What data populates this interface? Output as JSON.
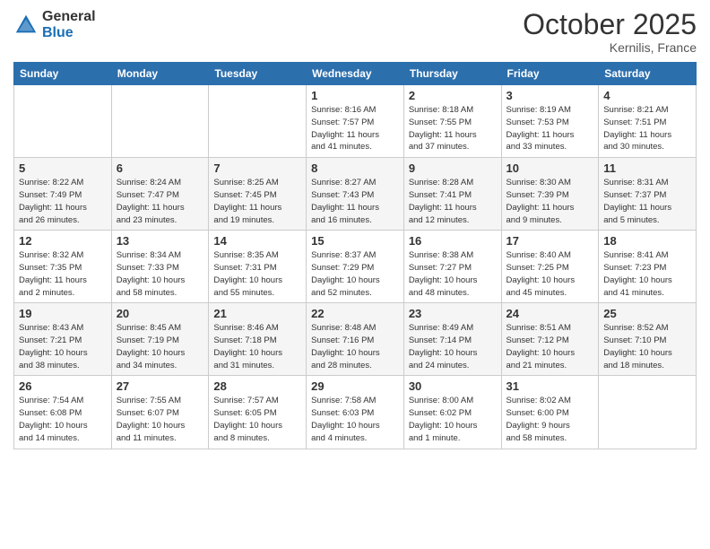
{
  "logo": {
    "general": "General",
    "blue": "Blue"
  },
  "header": {
    "month": "October 2025",
    "location": "Kernilis, France"
  },
  "weekdays": [
    "Sunday",
    "Monday",
    "Tuesday",
    "Wednesday",
    "Thursday",
    "Friday",
    "Saturday"
  ],
  "weeks": [
    [
      {
        "day": "",
        "info": ""
      },
      {
        "day": "",
        "info": ""
      },
      {
        "day": "",
        "info": ""
      },
      {
        "day": "1",
        "info": "Sunrise: 8:16 AM\nSunset: 7:57 PM\nDaylight: 11 hours\nand 41 minutes."
      },
      {
        "day": "2",
        "info": "Sunrise: 8:18 AM\nSunset: 7:55 PM\nDaylight: 11 hours\nand 37 minutes."
      },
      {
        "day": "3",
        "info": "Sunrise: 8:19 AM\nSunset: 7:53 PM\nDaylight: 11 hours\nand 33 minutes."
      },
      {
        "day": "4",
        "info": "Sunrise: 8:21 AM\nSunset: 7:51 PM\nDaylight: 11 hours\nand 30 minutes."
      }
    ],
    [
      {
        "day": "5",
        "info": "Sunrise: 8:22 AM\nSunset: 7:49 PM\nDaylight: 11 hours\nand 26 minutes."
      },
      {
        "day": "6",
        "info": "Sunrise: 8:24 AM\nSunset: 7:47 PM\nDaylight: 11 hours\nand 23 minutes."
      },
      {
        "day": "7",
        "info": "Sunrise: 8:25 AM\nSunset: 7:45 PM\nDaylight: 11 hours\nand 19 minutes."
      },
      {
        "day": "8",
        "info": "Sunrise: 8:27 AM\nSunset: 7:43 PM\nDaylight: 11 hours\nand 16 minutes."
      },
      {
        "day": "9",
        "info": "Sunrise: 8:28 AM\nSunset: 7:41 PM\nDaylight: 11 hours\nand 12 minutes."
      },
      {
        "day": "10",
        "info": "Sunrise: 8:30 AM\nSunset: 7:39 PM\nDaylight: 11 hours\nand 9 minutes."
      },
      {
        "day": "11",
        "info": "Sunrise: 8:31 AM\nSunset: 7:37 PM\nDaylight: 11 hours\nand 5 minutes."
      }
    ],
    [
      {
        "day": "12",
        "info": "Sunrise: 8:32 AM\nSunset: 7:35 PM\nDaylight: 11 hours\nand 2 minutes."
      },
      {
        "day": "13",
        "info": "Sunrise: 8:34 AM\nSunset: 7:33 PM\nDaylight: 10 hours\nand 58 minutes."
      },
      {
        "day": "14",
        "info": "Sunrise: 8:35 AM\nSunset: 7:31 PM\nDaylight: 10 hours\nand 55 minutes."
      },
      {
        "day": "15",
        "info": "Sunrise: 8:37 AM\nSunset: 7:29 PM\nDaylight: 10 hours\nand 52 minutes."
      },
      {
        "day": "16",
        "info": "Sunrise: 8:38 AM\nSunset: 7:27 PM\nDaylight: 10 hours\nand 48 minutes."
      },
      {
        "day": "17",
        "info": "Sunrise: 8:40 AM\nSunset: 7:25 PM\nDaylight: 10 hours\nand 45 minutes."
      },
      {
        "day": "18",
        "info": "Sunrise: 8:41 AM\nSunset: 7:23 PM\nDaylight: 10 hours\nand 41 minutes."
      }
    ],
    [
      {
        "day": "19",
        "info": "Sunrise: 8:43 AM\nSunset: 7:21 PM\nDaylight: 10 hours\nand 38 minutes."
      },
      {
        "day": "20",
        "info": "Sunrise: 8:45 AM\nSunset: 7:19 PM\nDaylight: 10 hours\nand 34 minutes."
      },
      {
        "day": "21",
        "info": "Sunrise: 8:46 AM\nSunset: 7:18 PM\nDaylight: 10 hours\nand 31 minutes."
      },
      {
        "day": "22",
        "info": "Sunrise: 8:48 AM\nSunset: 7:16 PM\nDaylight: 10 hours\nand 28 minutes."
      },
      {
        "day": "23",
        "info": "Sunrise: 8:49 AM\nSunset: 7:14 PM\nDaylight: 10 hours\nand 24 minutes."
      },
      {
        "day": "24",
        "info": "Sunrise: 8:51 AM\nSunset: 7:12 PM\nDaylight: 10 hours\nand 21 minutes."
      },
      {
        "day": "25",
        "info": "Sunrise: 8:52 AM\nSunset: 7:10 PM\nDaylight: 10 hours\nand 18 minutes."
      }
    ],
    [
      {
        "day": "26",
        "info": "Sunrise: 7:54 AM\nSunset: 6:08 PM\nDaylight: 10 hours\nand 14 minutes."
      },
      {
        "day": "27",
        "info": "Sunrise: 7:55 AM\nSunset: 6:07 PM\nDaylight: 10 hours\nand 11 minutes."
      },
      {
        "day": "28",
        "info": "Sunrise: 7:57 AM\nSunset: 6:05 PM\nDaylight: 10 hours\nand 8 minutes."
      },
      {
        "day": "29",
        "info": "Sunrise: 7:58 AM\nSunset: 6:03 PM\nDaylight: 10 hours\nand 4 minutes."
      },
      {
        "day": "30",
        "info": "Sunrise: 8:00 AM\nSunset: 6:02 PM\nDaylight: 10 hours\nand 1 minute."
      },
      {
        "day": "31",
        "info": "Sunrise: 8:02 AM\nSunset: 6:00 PM\nDaylight: 9 hours\nand 58 minutes."
      },
      {
        "day": "",
        "info": ""
      }
    ]
  ]
}
